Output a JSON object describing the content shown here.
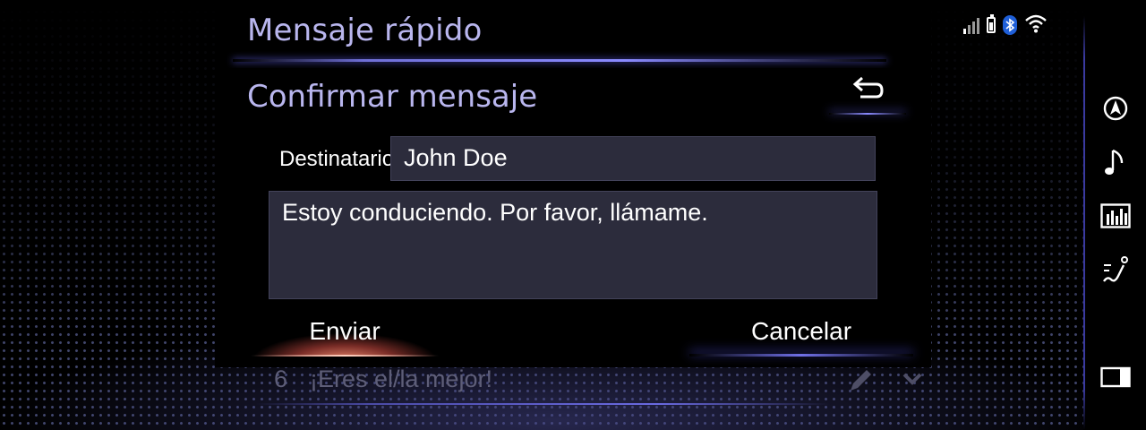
{
  "header": {
    "title": "Mensaje rápido"
  },
  "status": {
    "signal": "signal-icon",
    "battery": "battery-icon",
    "bluetooth": "bluetooth-icon",
    "wifi": "wifi-icon"
  },
  "dialog": {
    "title": "Confirmar mensaje",
    "recipient_label": "Destinatario:",
    "recipient_value": "John Doe",
    "message": "Estoy conduciendo. Por favor, llámame.",
    "send_label": "Enviar",
    "cancel_label": "Cancelar"
  },
  "list": {
    "row_number": "6",
    "row_text": "¡Eres el/la mejor!"
  },
  "rail": [
    "navigation-icon",
    "music-icon",
    "equalizer-icon",
    "seat-climate-icon",
    "screen-split-icon"
  ],
  "colors": {
    "title": "#b9b6ee",
    "accent": "#7070e8",
    "send_glow": "#ff9678",
    "field_bg": "#2c2c3c"
  }
}
